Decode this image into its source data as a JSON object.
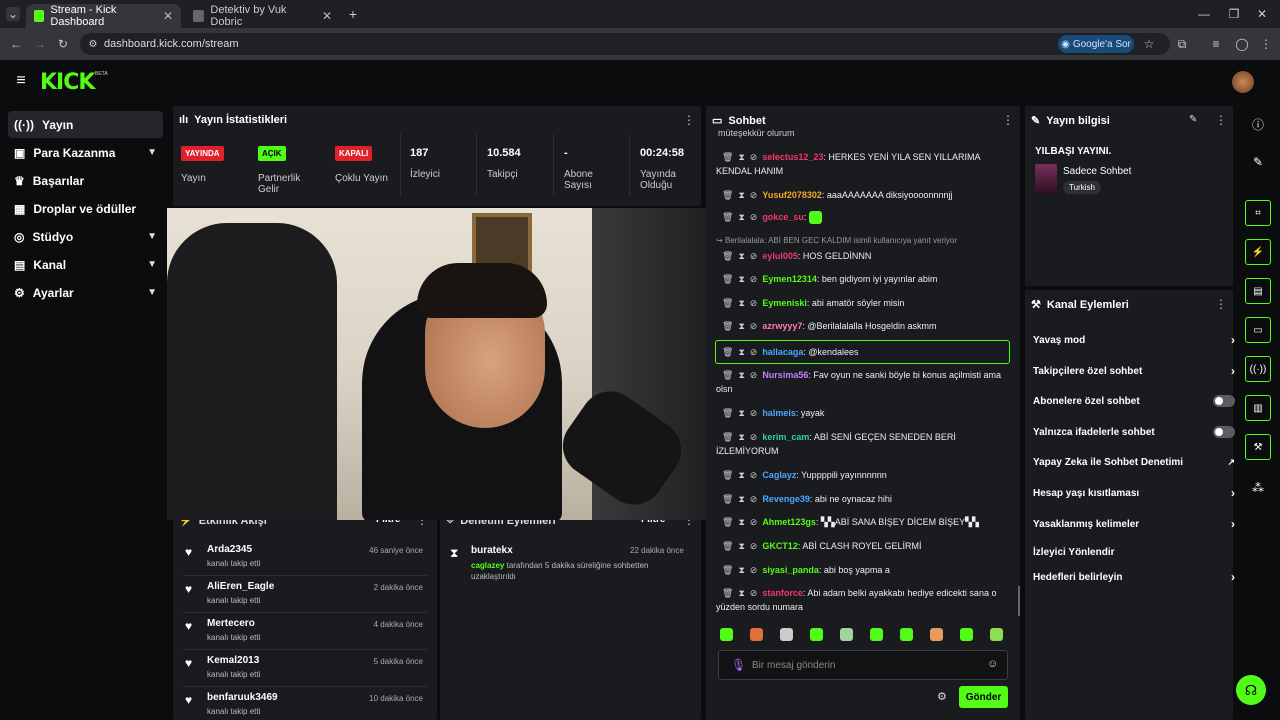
{
  "browser": {
    "tabs": [
      {
        "title": "Stream - Kick Dashboard",
        "active": true
      },
      {
        "title": "Detektiv by Vuk Dobric",
        "active": false
      }
    ],
    "url": "dashboard.kick.com/stream",
    "google_button": "Google'a Sor"
  },
  "brand": {
    "logo": "KICK",
    "beta": "BETA",
    "accent": "#53fc18"
  },
  "sidebar": {
    "items": [
      {
        "label": "Yayın",
        "icon": "broadcast-icon",
        "active": true,
        "expandable": false
      },
      {
        "label": "Para Kazanma",
        "icon": "wallet-icon",
        "active": false,
        "expandable": true
      },
      {
        "label": "Başarılar",
        "icon": "trophy-icon",
        "active": false,
        "expandable": false
      },
      {
        "label": "Droplar ve ödüller",
        "icon": "gift-icon",
        "active": false,
        "expandable": false
      },
      {
        "label": "Stüdyo",
        "icon": "studio-icon",
        "active": false,
        "expandable": true
      },
      {
        "label": "Kanal",
        "icon": "channel-icon",
        "active": false,
        "expandable": true
      },
      {
        "label": "Ayarlar",
        "icon": "gear-icon",
        "active": false,
        "expandable": true
      }
    ]
  },
  "stats": {
    "title": "Yayın İstatistikleri",
    "yayinda_badge": "YAYINDA",
    "yayin_label": "Yayın",
    "acik_badge": "AÇIK",
    "partner_label": "Partnerlik Gelir",
    "kapali_badge": "KAPALI",
    "coklu_label": "Çoklu Yayın",
    "viewers_value": "187",
    "viewers_label": "İzleyici",
    "followers_value": "10.584",
    "followers_label": "Takipçi",
    "subs_value": "-",
    "subs_label": "Abone Sayısı",
    "uptime_value": "00:24:58",
    "uptime_label": "Yayında Olduğu"
  },
  "activity": {
    "title": "Etkinlik Akışı",
    "filter": "Filtre",
    "items": [
      {
        "name": "Arda2345",
        "sub": "kanalı takip etti",
        "time": "46 saniye önce"
      },
      {
        "name": "AliEren_Eagle",
        "sub": "kanalı takip etti",
        "time": "2 dakika önce"
      },
      {
        "name": "Mertecero",
        "sub": "kanalı takip etti",
        "time": "4 dakika önce"
      },
      {
        "name": "Kemal2013",
        "sub": "kanalı takip etti",
        "time": "5 dakika önce"
      },
      {
        "name": "benfaruuk3469",
        "sub": "kanalı takip etti",
        "time": "10 dakika önce"
      }
    ]
  },
  "moderation": {
    "title": "Denetim Eylemleri",
    "filter": "Filtre",
    "item": {
      "name": "buratekx",
      "time": "22 dakika önce",
      "actor": "caglazey",
      "text": "tarafından 5 dakika süreliğine sohbetten uzaklaştırıldı"
    }
  },
  "chat": {
    "title": "Sohbet",
    "top_cut": "müteşekkür olurum",
    "messages": [
      {
        "user": "selectus12_23",
        "color": "#f0386b",
        "text": "HERKES YENİ YILA SEN YILLARIMA KENDAL HANIM"
      },
      {
        "user": "Yusuf2078302",
        "color": "#f9a825",
        "text": "aaaAAAAAAA diksiyoooonnnnjj"
      },
      {
        "user": "gokce_su",
        "color": "#f0386b",
        "text": "",
        "emote": true
      },
      {
        "user": "eylul005",
        "color": "#f0386b",
        "text": "HOS GELDİNNN",
        "reply": "Berilalalala: ABİ BEN GEC KALDIM isimli kullanıcıya yanıt veriyor"
      },
      {
        "user": "Eymen12314",
        "color": "#53fc18",
        "text": "ben gidiyom iyi yayınlar abim"
      },
      {
        "user": "Eymeniski",
        "color": "#53fc18",
        "text": "abi amatör söyler misin"
      },
      {
        "user": "azrwyyy7",
        "color": "#ff7aa8",
        "text": "@Berilalalalla Hosgeldin askmm"
      },
      {
        "user": "hallacaga",
        "color": "#4aa8ff",
        "text": "@kendalees",
        "highlight": true
      },
      {
        "user": "Nursima56",
        "color": "#c77dff",
        "text": "Fav oyun ne sanki böyle bi konus açilmisti ama olsn"
      },
      {
        "user": "halmeis",
        "color": "#4aa8ff",
        "text": "yayak"
      },
      {
        "user": "kerim_cam",
        "color": "#2ecfa0",
        "text": "ABİ SENİ GEÇEN SENEDEN BERİ İZLEMİYORUM"
      },
      {
        "user": "Caglayz",
        "color": "#4aa8ff",
        "text": "Yuppppili yayınnnnnn"
      },
      {
        "user": "Revenge39",
        "color": "#4aa8ff",
        "text": "abi ne oynacaz hihi"
      },
      {
        "user": "Ahmet123gs",
        "color": "#53fc18",
        "text": "▚▚ABİ SANA BİŞEY DİCEM BİŞEY▚▚"
      },
      {
        "user": "GKCT12",
        "color": "#53fc18",
        "text": "ABİ CLASH ROYEL GELİRMİ"
      },
      {
        "user": "siyasi_panda",
        "color": "#53fc18",
        "text": "abi boş yapma a"
      },
      {
        "user": "stanforce",
        "color": "#f0386b",
        "text": "Abi adam belki ayakkabı hediye edicekti sana o yüzden sordu numara"
      }
    ],
    "placeholder": "Bir mesaj gönderin",
    "send": "Gönder"
  },
  "stream_info": {
    "title": "Yayın bilgisi",
    "stream_title": "YILBAŞI YAYINI.",
    "category": "Sadece Sohbet",
    "tag": "Turkish"
  },
  "channel_actions": {
    "title": "Kanal Eylemleri",
    "items": [
      {
        "label": "Yavaş mod",
        "kind": "chevron"
      },
      {
        "label": "Takipçilere özel sohbet",
        "kind": "chevron"
      },
      {
        "label": "Abonelere özel sohbet",
        "kind": "toggle"
      },
      {
        "label": "Yalnızca ifadelerle sohbet",
        "kind": "toggle"
      },
      {
        "label": "Yapay Zeka ile Sohbet Denetimi",
        "kind": "external"
      },
      {
        "label": "Hesap yaşı kısıtlaması",
        "kind": "chevron"
      },
      {
        "label": "Yasaklanmış kelimeler",
        "kind": "chevron"
      },
      {
        "label": "İzleyici Yönlendir",
        "kind": "none"
      },
      {
        "label": "Hedefleri belirleyin",
        "kind": "chevron"
      }
    ]
  }
}
